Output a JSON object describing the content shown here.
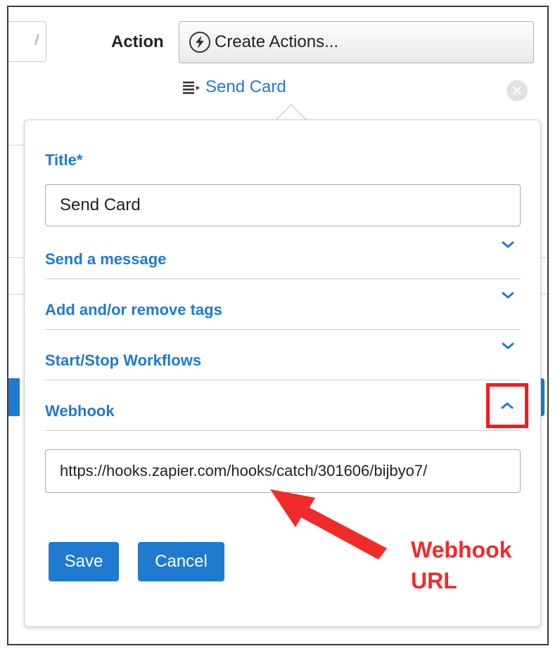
{
  "header": {
    "action_label": "Action",
    "create_actions_label": "Create Actions...",
    "create_actions_icon": "lightning-bolt-icon",
    "send_card_link": "Send Card",
    "send_card_icon": "list-icon",
    "close_icon": "close-circle-icon"
  },
  "form": {
    "title_label": "Title*",
    "title_value": "Send Card",
    "sections": [
      {
        "label": "Send a message",
        "state": "collapsed"
      },
      {
        "label": "Add and/or remove tags",
        "state": "collapsed"
      },
      {
        "label": "Start/Stop Workflows",
        "state": "collapsed"
      },
      {
        "label": "Webhook",
        "state": "expanded"
      }
    ],
    "webhook_url": "https://hooks.zapier.com/hooks/catch/301606/bijbyo7/",
    "save_label": "Save",
    "cancel_label": "Cancel"
  },
  "annotation": {
    "line1": "Webhook",
    "line2": "URL"
  },
  "colors": {
    "link_blue": "#1f7ad0",
    "highlight_red": "#f11d1d"
  }
}
